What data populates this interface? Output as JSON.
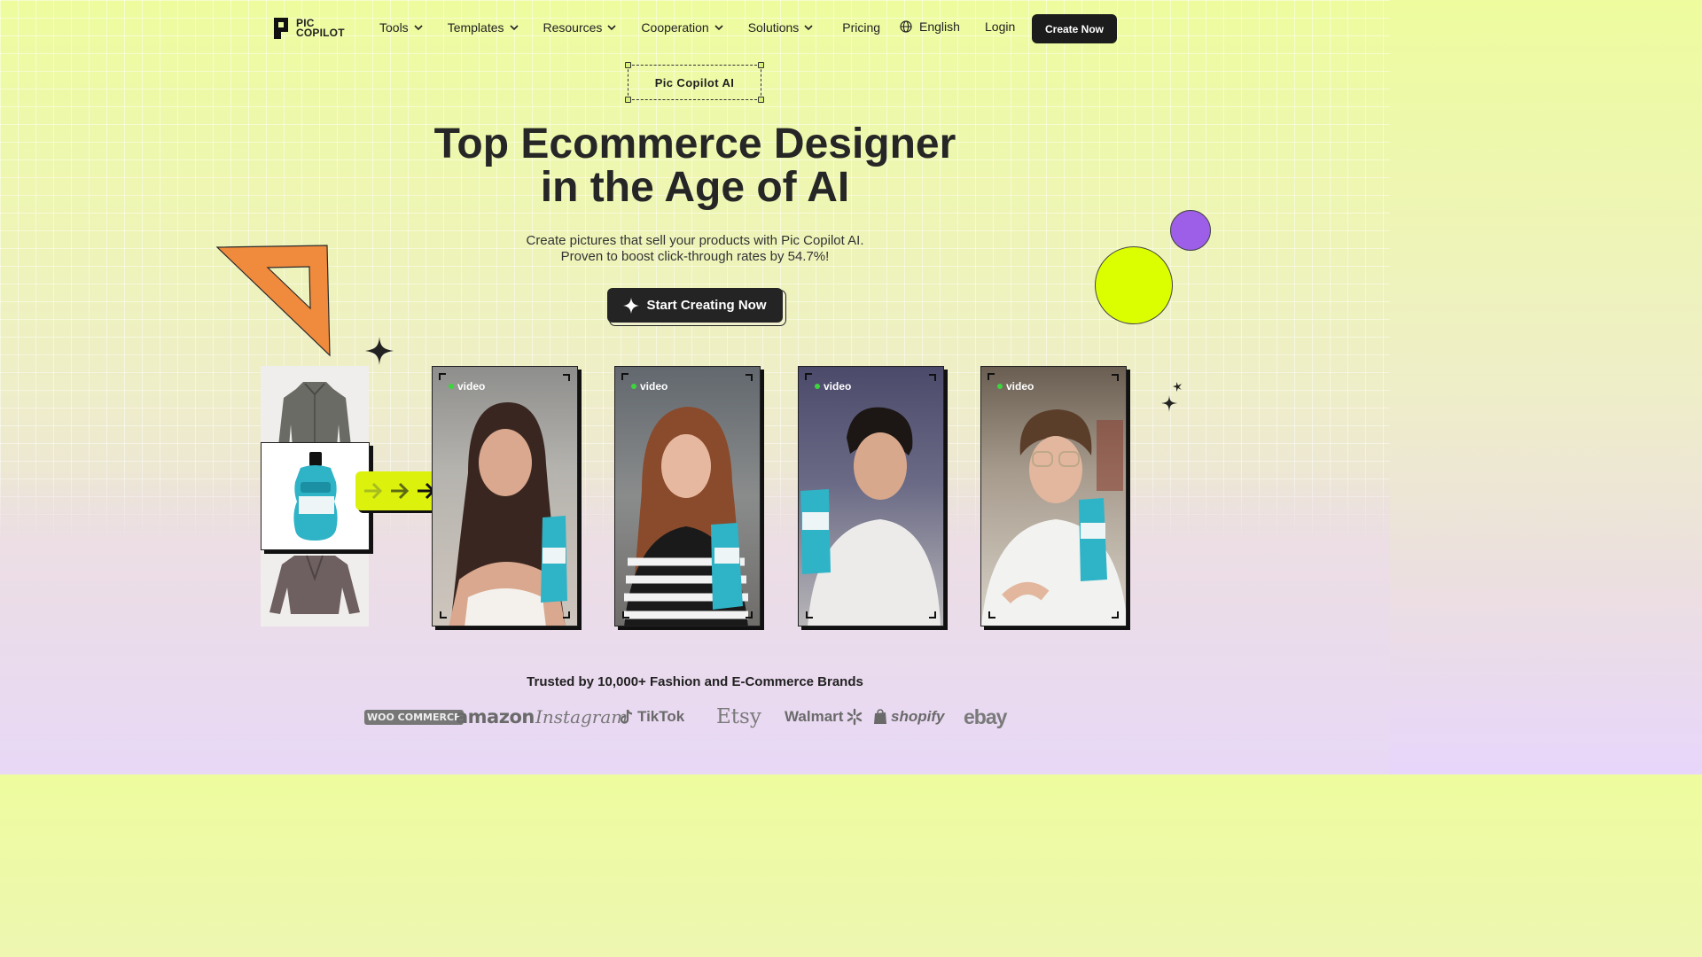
{
  "header": {
    "logo_line1": "PIC",
    "logo_line2": "COPILOT",
    "menu": [
      {
        "label": "Tools",
        "has_dropdown": true
      },
      {
        "label": "Templates",
        "has_dropdown": true
      },
      {
        "label": "Resources",
        "has_dropdown": true
      },
      {
        "label": "Cooperation",
        "has_dropdown": true
      },
      {
        "label": "Solutions",
        "has_dropdown": true
      },
      {
        "label": "Pricing",
        "has_dropdown": false
      }
    ],
    "language": "English",
    "login": "Login",
    "cta": "Create Now"
  },
  "hero": {
    "badge": "Pic Copilot AI",
    "title_line1": "Top Ecommerce Designer",
    "title_line2": "in the Age of AI",
    "subtitle_line1": "Create pictures that sell your products with Pic Copilot AI.",
    "subtitle_line2": "Proven to boost click-through rates by 54.7%!",
    "cta": "Start Creating Now"
  },
  "showcase": {
    "video_tag": "video",
    "cards": [
      {
        "tag": "video",
        "person": "woman-dark-hair-white-top"
      },
      {
        "tag": "video",
        "person": "woman-auburn-hair-striped-top"
      },
      {
        "tag": "video",
        "person": "man-dark-hair-white-sweater"
      },
      {
        "tag": "video",
        "person": "man-glasses-white-sweater"
      }
    ]
  },
  "trust": {
    "text": "Trusted by 10,000+ Fashion and E-Commerce Brands",
    "brands": [
      "WOO COMMERCE",
      "amazon",
      "Instagram",
      "TikTok",
      "Etsy",
      "Walmart",
      "shopify",
      "ebay"
    ]
  },
  "colors": {
    "accent_lime": "#dcf20c",
    "accent_orange": "#f08a3c",
    "accent_purple": "#9d5ee8",
    "dark": "#1c1c1c"
  }
}
